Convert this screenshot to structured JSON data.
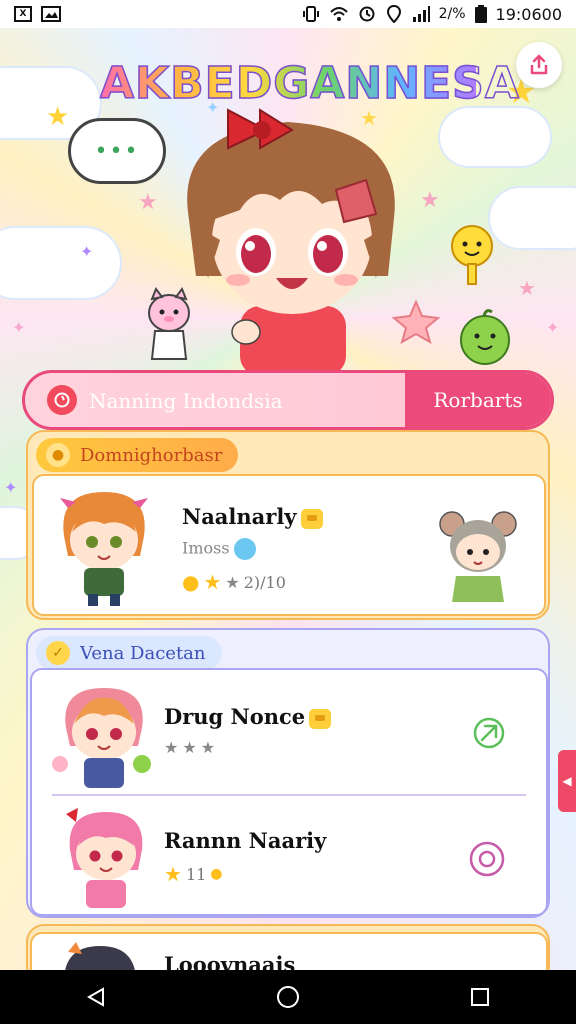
{
  "status_bar": {
    "left_icons": [
      "notification-icon",
      "gallery-icon"
    ],
    "left_box_label": "X",
    "right_icons": [
      "vibrate-icon",
      "wifi-icon",
      "sync-icon",
      "location-icon",
      "signal-icon",
      "battery-icon"
    ],
    "battery_text": "2/%",
    "time": "19:0600"
  },
  "header": {
    "app_title": "AKBEDGANNESA",
    "speech_bubble_text": "•••",
    "share_icon": "share-icon"
  },
  "search": {
    "label": "Nanning Indondsia",
    "action_label": "Rorbarts",
    "icon": "search-icon"
  },
  "sections": [
    {
      "title": "Domnighorbasr",
      "color": "#f6b955",
      "cards": [
        {
          "name": "Naalnarly",
          "subtitle": "Imoss",
          "rating_text": "2)/10",
          "badge": "crown-icon"
        }
      ]
    },
    {
      "title": "Vena Dacetan",
      "color": "#a9a5f0",
      "cards": [
        {
          "name": "Drug Nonce",
          "subtitle": "",
          "rating_text": "",
          "action_icon": "send-icon"
        },
        {
          "name": "Rannn Naariy",
          "subtitle": "",
          "rating_text": "11",
          "action_icon": "chat-icon"
        }
      ]
    },
    {
      "title": "",
      "cards": [
        {
          "name": "Looovnaais"
        }
      ]
    }
  ],
  "nav": {
    "back": "back-icon",
    "home": "home-icon",
    "recents": "recents-icon"
  },
  "colors": {
    "accent": "#ec4a7a",
    "search_border": "#e9497b",
    "gold": "#ffcf3a"
  }
}
